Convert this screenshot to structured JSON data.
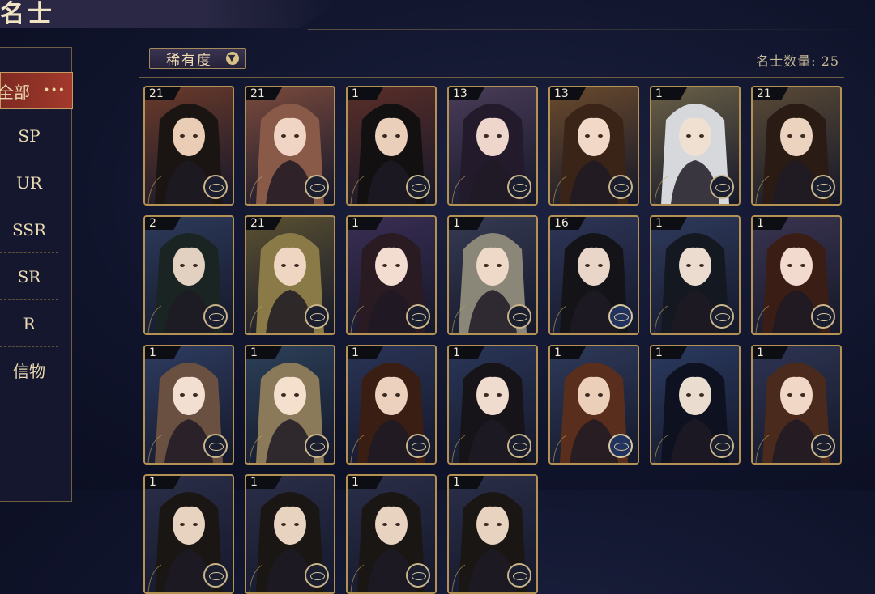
{
  "header": {
    "title": "名士"
  },
  "sidebar": {
    "items": [
      {
        "label": "全部",
        "active": true
      },
      {
        "label": "SP"
      },
      {
        "label": "UR"
      },
      {
        "label": "SSR"
      },
      {
        "label": "SR"
      },
      {
        "label": "R"
      },
      {
        "label": "信物"
      }
    ]
  },
  "toolbar": {
    "sort_label": "稀有度",
    "count_text": "名士数量: 25"
  },
  "cards": [
    {
      "level": "21",
      "bg": "#6b3a2a",
      "hair": "#1a1412",
      "skin": "#e9cdb5",
      "badge": "gold"
    },
    {
      "level": "21",
      "bg": "#7a4a3c",
      "hair": "#8a5a48",
      "skin": "#f1d5c4",
      "badge": "gold"
    },
    {
      "level": "1",
      "bg": "#5a2e28",
      "hair": "#121010",
      "skin": "#ead0bb",
      "badge": "gold"
    },
    {
      "level": "13",
      "bg": "#4a3c58",
      "hair": "#231b2c",
      "skin": "#efd6cc",
      "badge": "gold"
    },
    {
      "level": "13",
      "bg": "#6a4a2c",
      "hair": "#3a2418",
      "skin": "#f2d8c6",
      "badge": "gold"
    },
    {
      "level": "1",
      "bg": "#6a6046",
      "hair": "#d6d8dc",
      "skin": "#efe0d2",
      "badge": "gold"
    },
    {
      "level": "21",
      "bg": "#5a4a36",
      "hair": "#2a1c14",
      "skin": "#ecd3c0",
      "badge": "gold"
    },
    {
      "level": "2",
      "bg": "#2c3a5a",
      "hair": "#1a2422",
      "skin": "#e2d0c0",
      "badge": "gold"
    },
    {
      "level": "21",
      "bg": "#5a5030",
      "hair": "#8a7a48",
      "skin": "#efd6c2",
      "badge": "gold"
    },
    {
      "level": "1",
      "bg": "#3a2e54",
      "hair": "#2a1a22",
      "skin": "#f3dcd0",
      "badge": "gold"
    },
    {
      "level": "1",
      "bg": "#363a52",
      "hair": "#8a8678",
      "skin": "#eed9c8",
      "badge": "gold"
    },
    {
      "level": "16",
      "bg": "#2e3658",
      "hair": "#141418",
      "skin": "#ead6c8",
      "badge": "blue"
    },
    {
      "level": "1",
      "bg": "#2e3a5c",
      "hair": "#141820",
      "skin": "#ecdccf",
      "badge": "gold"
    },
    {
      "level": "1",
      "bg": "#3a3450",
      "hair": "#3a1e16",
      "skin": "#f2dace",
      "badge": "gold"
    },
    {
      "level": "1",
      "bg": "#2e3c60",
      "hair": "#6a5040",
      "skin": "#f3dfd2",
      "badge": "gold"
    },
    {
      "level": "1",
      "bg": "#2c4058",
      "hair": "#8a7a5a",
      "skin": "#f4e0cc",
      "badge": "gold"
    },
    {
      "level": "1",
      "bg": "#2a3456",
      "hair": "#3a1e14",
      "skin": "#ecd2be",
      "badge": "gold"
    },
    {
      "level": "1",
      "bg": "#2a3658",
      "hair": "#161418",
      "skin": "#efdccf",
      "badge": "gold"
    },
    {
      "level": "1",
      "bg": "#2e3a5a",
      "hair": "#5a2e1c",
      "skin": "#eccfb8",
      "badge": "blue"
    },
    {
      "level": "1",
      "bg": "#2a3a60",
      "hair": "#0e1220",
      "skin": "#eadccf",
      "badge": "gold"
    },
    {
      "level": "1",
      "bg": "#2e3452",
      "hair": "#4a2a1c",
      "skin": "#f1d8c6",
      "badge": "gold"
    },
    {
      "level": "1",
      "bg": "#2a2e48",
      "hair": "#1a1614",
      "skin": "#e8d2c0",
      "badge": "gold"
    },
    {
      "level": "1",
      "bg": "#2a2e48",
      "hair": "#1a1614",
      "skin": "#e8d2c0",
      "badge": "gold"
    },
    {
      "level": "1",
      "bg": "#2a2e48",
      "hair": "#1a1614",
      "skin": "#e8d2c0",
      "badge": "gold"
    },
    {
      "level": "1",
      "bg": "#2a2e48",
      "hair": "#1a1614",
      "skin": "#e8d2c0",
      "badge": "gold"
    }
  ]
}
